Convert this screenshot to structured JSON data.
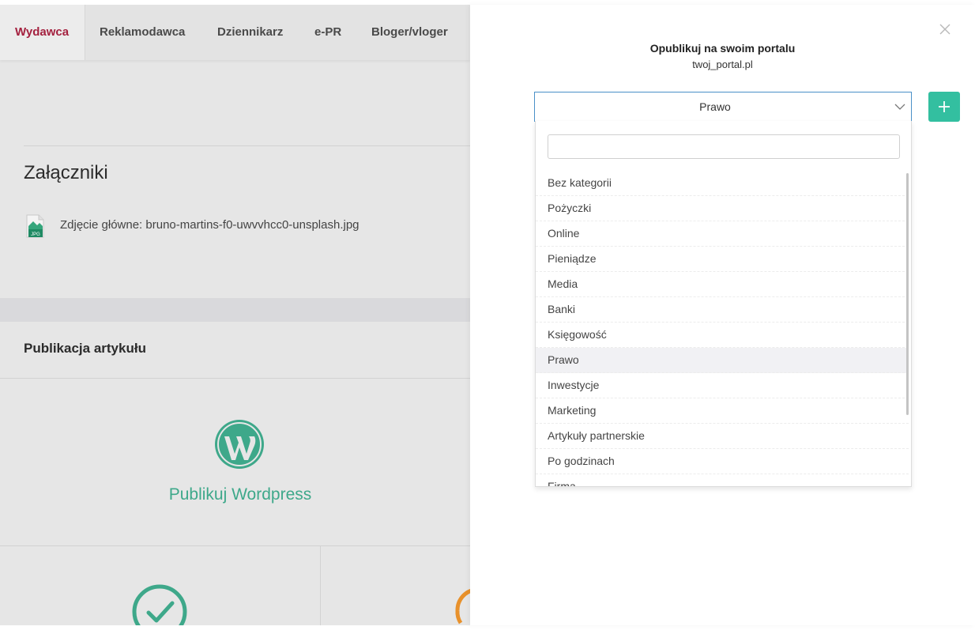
{
  "nav": {
    "items": [
      {
        "label": "Wydawca",
        "active": true
      },
      {
        "label": "Reklamodawca",
        "active": false
      },
      {
        "label": "Dziennikarz",
        "active": false
      },
      {
        "label": "e-PR",
        "active": false
      },
      {
        "label": "Bloger/vloger",
        "active": false
      }
    ]
  },
  "attachments": {
    "title": "Załączniki",
    "file_label": "Zdjęcie główne: bruno-martins-f0-uwvvhcc0-unsplash.jpg",
    "file_icon": "jpg-file-icon",
    "file_icon_text": "JPG"
  },
  "publication": {
    "title": "Publikacja artykułu",
    "wordpress_label": "Publikuj Wordpress",
    "wordpress_icon": "wordpress-icon"
  },
  "modal": {
    "title": "Opublikuj na swoim portalu",
    "subtitle": "twoj_portal.pl",
    "selected_category": "Prawo",
    "add_button_label": "+",
    "search": {
      "value": "",
      "placeholder": ""
    },
    "options": [
      "Bez kategorii",
      "Pożyczki",
      "Online",
      "Pieniądze",
      "Media",
      "Banki",
      "Księgowość",
      "Prawo",
      "Inwestycje",
      "Marketing",
      "Artykuły partnerskie",
      "Po godzinach",
      "Firma"
    ]
  },
  "colors": {
    "accent_green": "#33bfa0",
    "active_nav": "#a4213f",
    "select_border": "#4a90c8",
    "check_green": "#3ea88a",
    "pending_orange": "#e8912b"
  }
}
